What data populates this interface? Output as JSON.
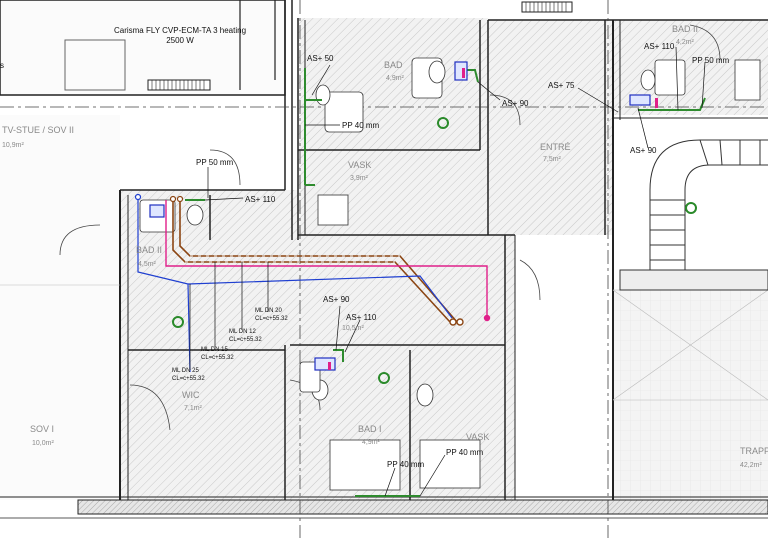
{
  "heater": {
    "model": "Carisma FLY CVP-ECM-TA 3 heating",
    "power": "2500 W"
  },
  "rooms": {
    "tv_stue_sov": {
      "name": "TV-STUE / SOV II",
      "area": "10,9m²"
    },
    "bad_top": {
      "name": "BAD",
      "area": "4,9m²"
    },
    "vask_top": {
      "name": "VASK",
      "area": "3,9m²"
    },
    "entre": {
      "name": "ENTRÉ",
      "area": "7,5m²"
    },
    "bad_ii": {
      "name": "BAD II",
      "area": "4,2m²"
    },
    "bad_ii_left": {
      "name": "BAD II",
      "area": "4,5m²"
    },
    "center": {
      "area": "10,5m²"
    },
    "wic": {
      "name": "WIC",
      "area": "7,1m²"
    },
    "sov_i": {
      "name": "SOV I",
      "area": "10,0m²"
    },
    "bad_i": {
      "name": "BAD I",
      "area": "4,9m²"
    },
    "vask_bottom": {
      "name": "VASK"
    },
    "trapp": {
      "name": "TRAPP",
      "area": "42,2m²"
    }
  },
  "labels": {
    "as50": "AS+ 50",
    "pp40_top": "PP 40 mm",
    "as90_top": "AS+ 90",
    "as75": "AS+ 75",
    "as110_right": "AS+ 110",
    "pp50_right": "PP 50 mm",
    "as90_right": "AS+ 90",
    "pp50_left": "PP 50 mm",
    "as110_left": "AS+ 110",
    "as90_center": "AS+ 90",
    "as110_center": "AS+ 110",
    "ml20": "ML DN 20",
    "ml20_cl": "CL=c+55.32",
    "ml15": "ML DN 15",
    "ml15_cl": "CL=c+55.32",
    "ml12": "ML DN 12",
    "ml12_cl": "CL=c+55.32",
    "ml25": "ML DN 25",
    "ml25_cl": "CL=c+55.32",
    "pp40_bottom": "PP 40 mm",
    "pp40_bottom2": "PP 40 mm",
    "side_mark": "s"
  },
  "colors": {
    "wall": "#222222",
    "hatch": "#bdbdbd",
    "drain_green": "#2e8b2e",
    "pipe_brown": "#8b4513",
    "pipe_magenta": "#e0208a",
    "pipe_blue": "#1f3fd0",
    "fixture_blue": "#2030c0",
    "circle_green": "#2a8a2a"
  }
}
